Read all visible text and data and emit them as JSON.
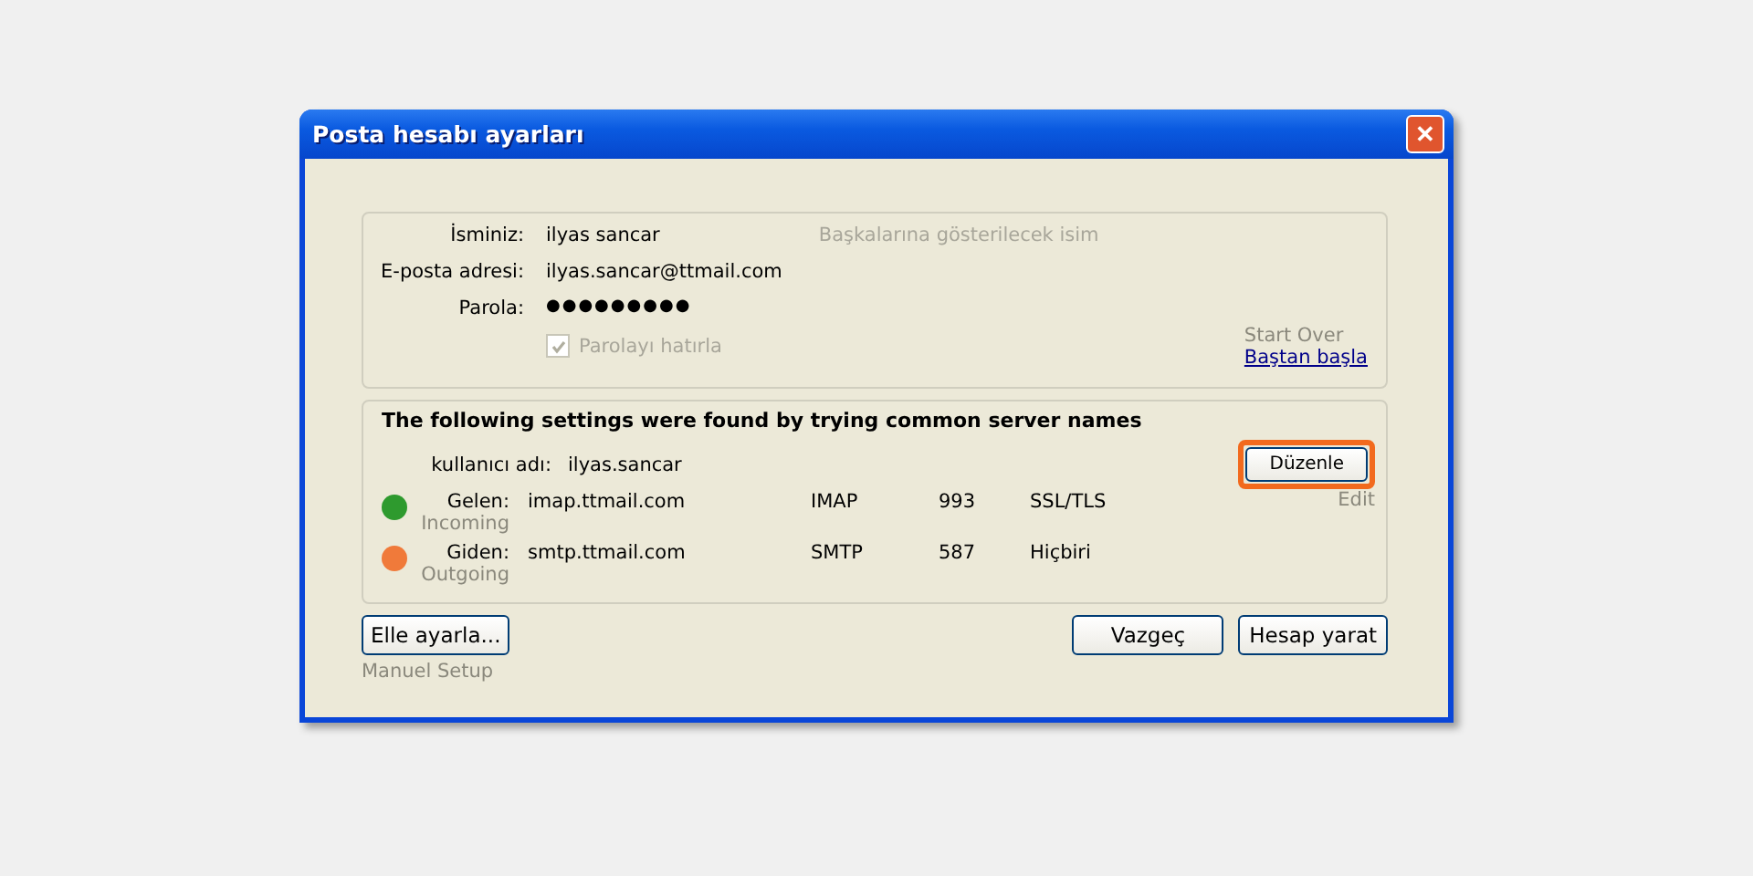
{
  "window": {
    "title": "Posta hesabı ayarları",
    "close": "✕"
  },
  "account": {
    "fields": [
      {
        "label": "İsminiz:",
        "value": "ilyas sancar",
        "hint": "Başkalarına gösterilecek isim",
        "kind": "text"
      },
      {
        "label": "E-posta adresi:",
        "value": "ilyas.sancar@ttmail.com",
        "kind": "text"
      },
      {
        "label": "Parola:",
        "value": "●●●●●●●●●",
        "kind": "password"
      }
    ],
    "remember": {
      "label": "Parolayı hatırla",
      "checked": true,
      "disabled": true
    },
    "start_over": {
      "caption": "Start Over",
      "link": "Baştan başla"
    }
  },
  "servers": {
    "heading": "The following settings were found by trying common server names",
    "username": {
      "label": "kullanıcı adı:",
      "value": "ilyas.sancar"
    },
    "edit": {
      "label": "Düzenle",
      "caption": "Edit",
      "highlighted": true
    },
    "rows": [
      {
        "label": "Gelen:",
        "caption": "Incoming",
        "host": "imap.ttmail.com",
        "protocol": "IMAP",
        "port": "993",
        "security": "SSL/TLS",
        "color": "#2e9a2e"
      },
      {
        "label": "Giden:",
        "caption": "Outgoing",
        "host": "smtp.ttmail.com",
        "protocol": "SMTP",
        "port": "587",
        "security": "Hiçbiri",
        "color": "#f07a3a"
      }
    ]
  },
  "buttons": {
    "manual": {
      "label": "Elle ayarla...",
      "caption": "Manuel Setup"
    },
    "cancel": "Vazgeç",
    "create": "Hesap yarat"
  }
}
